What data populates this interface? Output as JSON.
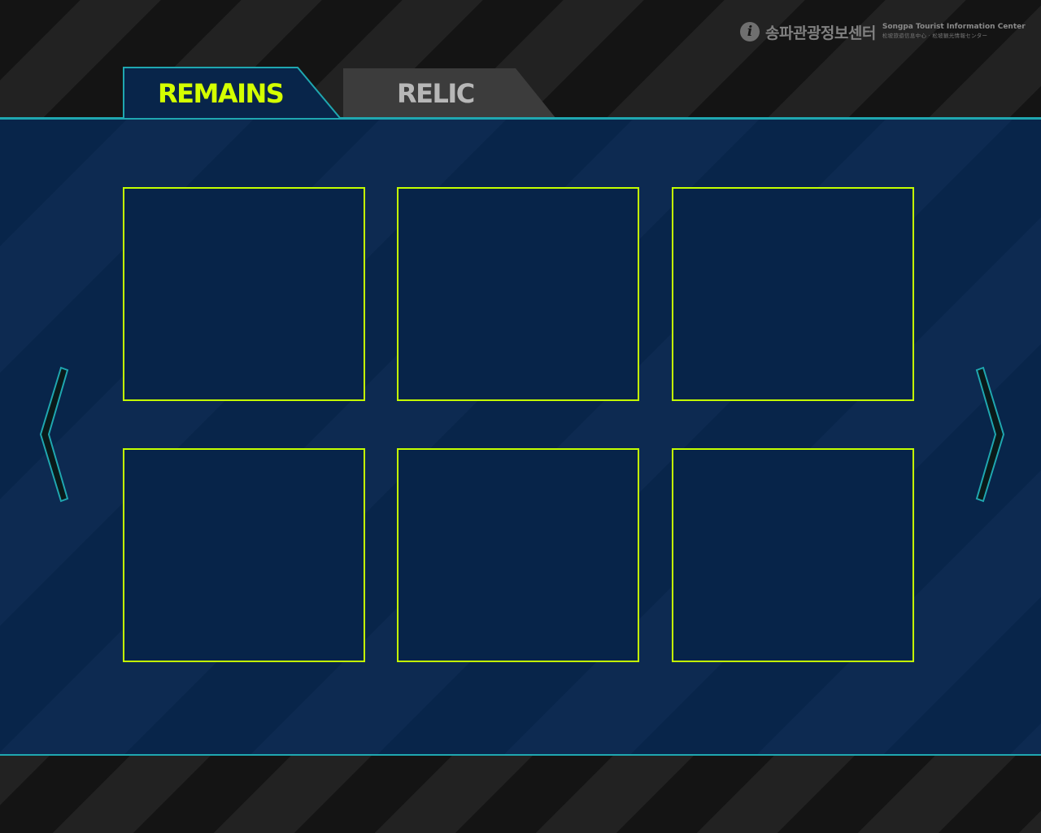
{
  "header": {
    "logo": {
      "icon": "info-icon",
      "icon_glyph": "i",
      "korean_name": "송파관광정보센터",
      "english_name": "Songpa Tourist Information Center",
      "cjk_name": "松坡旅遊信息中心 · 松坡観光情報センター"
    }
  },
  "tabs": [
    {
      "label": "REMAINS",
      "active": true
    },
    {
      "label": "RELIC",
      "active": false
    }
  ],
  "gallery": {
    "cards": [
      {
        "id": "card-1"
      },
      {
        "id": "card-2"
      },
      {
        "id": "card-3"
      },
      {
        "id": "card-4"
      },
      {
        "id": "card-5"
      },
      {
        "id": "card-6"
      }
    ],
    "prev_icon": "chevron-left-icon",
    "next_icon": "chevron-right-icon"
  },
  "colors": {
    "accent_lime": "#c3ff00",
    "border_teal": "#1fa7b0",
    "panel_navy": "#08254a",
    "tab_inactive": "#3c3c3c"
  }
}
